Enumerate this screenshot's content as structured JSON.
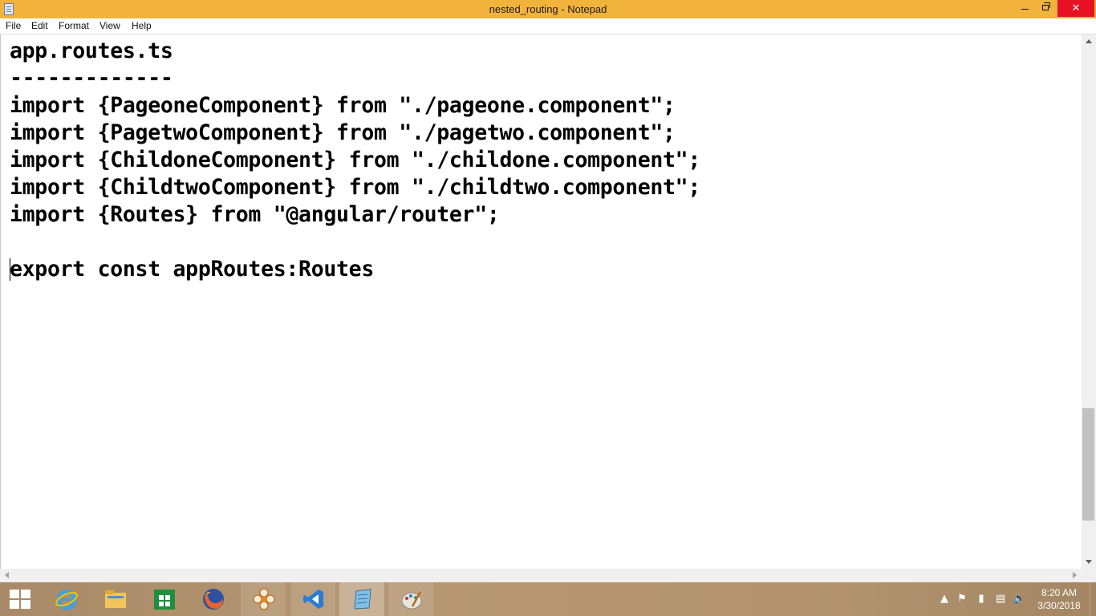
{
  "window": {
    "title": "nested_routing - Notepad"
  },
  "menu": {
    "items": [
      "File",
      "Edit",
      "Format",
      "View",
      "Help"
    ]
  },
  "editor": {
    "lines": [
      "app.routes.ts",
      "-------------",
      "import {PageoneComponent} from \"./pageone.component\";",
      "import {PagetwoComponent} from \"./pagetwo.component\";",
      "import {ChildoneComponent} from \"./childone.component\";",
      "import {ChildtwoComponent} from \"./childtwo.component\";",
      "import {Routes} from \"@angular/router\";",
      "",
      "export const appRoutes:Routes"
    ]
  },
  "taskbar": {
    "apps": [
      {
        "name": "internet-explorer-icon",
        "state": "normal"
      },
      {
        "name": "file-explorer-icon",
        "state": "normal"
      },
      {
        "name": "store-icon",
        "state": "normal"
      },
      {
        "name": "firefox-icon",
        "state": "normal"
      },
      {
        "name": "flower-app-icon",
        "state": "running"
      },
      {
        "name": "vscode-icon",
        "state": "running"
      },
      {
        "name": "notepad-icon",
        "state": "active"
      },
      {
        "name": "paint-icon",
        "state": "running"
      }
    ],
    "clock": {
      "time": "8:20 AM",
      "date": "3/30/2018"
    }
  },
  "colors": {
    "titlebar": "#f2b33d",
    "close_button": "#e81123",
    "taskbar": "#b3946f"
  }
}
